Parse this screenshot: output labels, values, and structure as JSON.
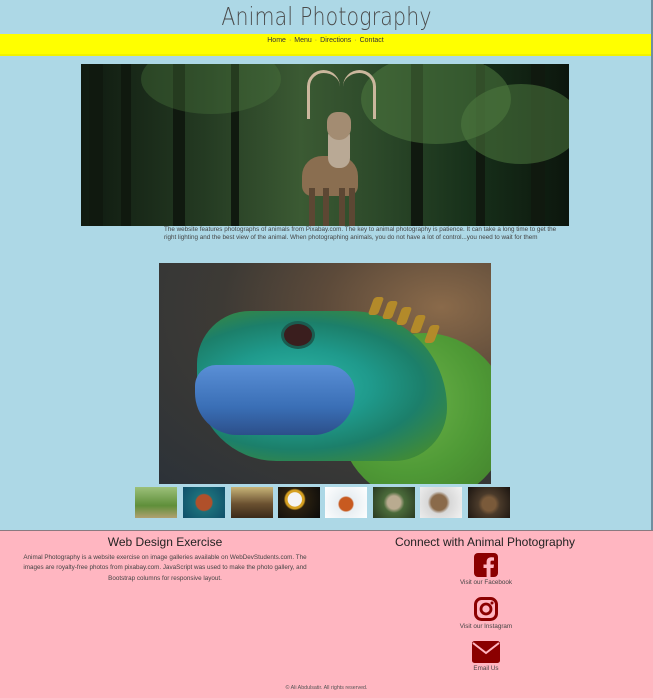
{
  "header": {
    "title": "Animal Photography"
  },
  "nav": {
    "items": [
      "Home",
      "Menu",
      "Directions",
      "Contact"
    ]
  },
  "main": {
    "caption": "The website features photographs of animals from Pixabay.com. The key to animal photography is patience. It can take a long time to get the right lighting and the best view of the animal. When photographing animals, you do not have a lot of control...you need to wait for them"
  },
  "thumbnails": [
    {
      "icon": "rabbit-thumbnail"
    },
    {
      "icon": "turtle-thumbnail"
    },
    {
      "icon": "bison-thumbnail"
    },
    {
      "icon": "eagle-thumbnail"
    },
    {
      "icon": "fox-thumbnail"
    },
    {
      "icon": "wolf-thumbnail"
    },
    {
      "icon": "ram-thumbnail"
    },
    {
      "icon": "bear-thumbnail"
    }
  ],
  "footer": {
    "left_title": "Web Design Exercise",
    "left_text": "Animal Photography is a website exercise on image galleries available on WebDevStudents.com. The images are royalty-free photos from pixabay.com. JavaScript was used to make the photo gallery, and Bootstrap columns for responsive layout.",
    "right_title": "Connect with Animal Photography",
    "facebook_label": "Visit our Facebook",
    "instagram_label": "Visit our Instagram",
    "email_label": "Email Us",
    "copyright": "© Ali Abdulsatir. All rights reserved."
  },
  "colors": {
    "page_bg": "#add8e6",
    "nav_bg": "#ffff00",
    "footer_bg": "#ffb6c1",
    "social_icon": "#8b0000"
  }
}
